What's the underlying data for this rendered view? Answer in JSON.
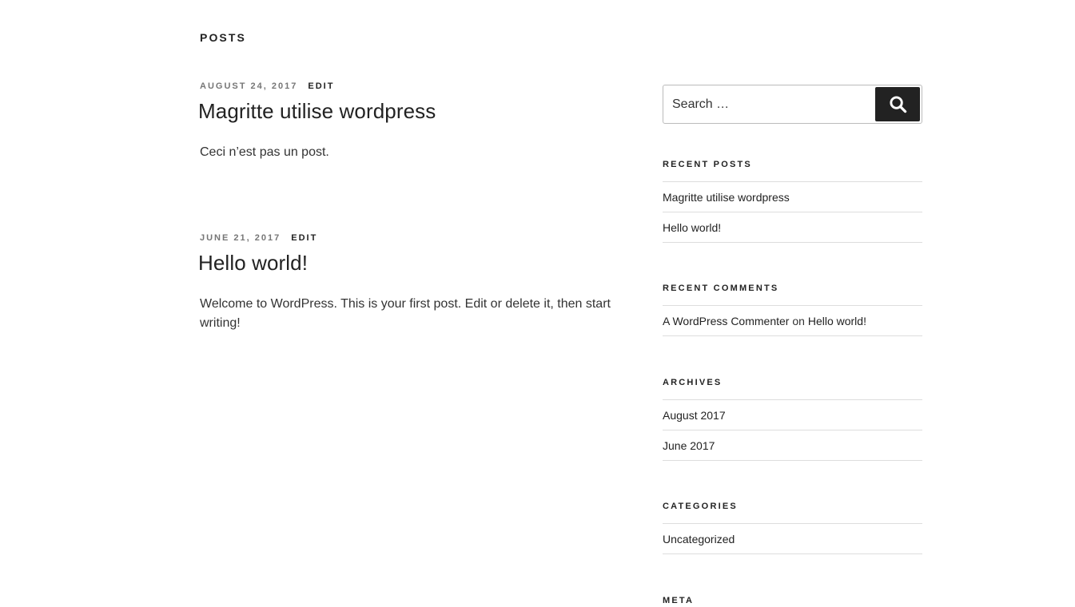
{
  "page": {
    "title": "POSTS"
  },
  "posts": [
    {
      "date": "AUGUST 24, 2017",
      "edit_label": "EDIT",
      "title": "Magritte utilise wordpress",
      "excerpt": "Ceci n’est pas un post."
    },
    {
      "date": "JUNE 21, 2017",
      "edit_label": "EDIT",
      "title": "Hello world!",
      "excerpt": "Welcome to WordPress. This is your first post. Edit or delete it, then start writing!"
    }
  ],
  "sidebar": {
    "search": {
      "placeholder": "Search …",
      "button_icon": "search-icon"
    },
    "recent_posts": {
      "title": "RECENT POSTS",
      "items": [
        "Magritte utilise wordpress",
        "Hello world!"
      ]
    },
    "recent_comments": {
      "title": "RECENT COMMENTS",
      "items": [
        {
          "author": "A WordPress Commenter",
          "on": "on",
          "post": "Hello world!"
        }
      ]
    },
    "archives": {
      "title": "ARCHIVES",
      "items": [
        "August 2017",
        "June 2017"
      ]
    },
    "categories": {
      "title": "CATEGORIES",
      "items": [
        "Uncategorized"
      ]
    },
    "meta": {
      "title": "META"
    }
  },
  "colors": {
    "text": "#333333",
    "heading": "#222222",
    "muted": "#767676",
    "divider": "#dddddd",
    "button": "#222222"
  }
}
